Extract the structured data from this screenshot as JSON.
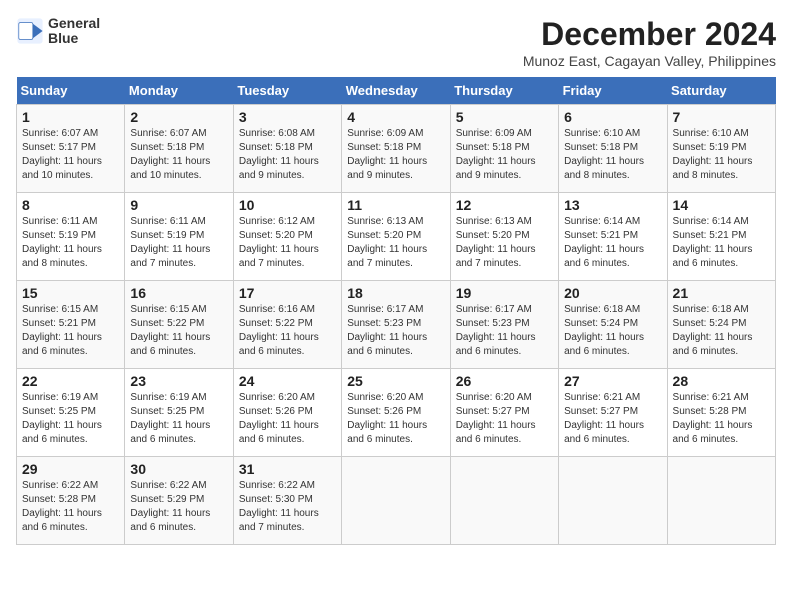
{
  "header": {
    "logo_line1": "General",
    "logo_line2": "Blue",
    "title": "December 2024",
    "subtitle": "Munoz East, Cagayan Valley, Philippines"
  },
  "days_of_week": [
    "Sunday",
    "Monday",
    "Tuesday",
    "Wednesday",
    "Thursday",
    "Friday",
    "Saturday"
  ],
  "weeks": [
    [
      {
        "day": 1,
        "info": "Sunrise: 6:07 AM\nSunset: 5:17 PM\nDaylight: 11 hours\nand 10 minutes."
      },
      {
        "day": 2,
        "info": "Sunrise: 6:07 AM\nSunset: 5:18 PM\nDaylight: 11 hours\nand 10 minutes."
      },
      {
        "day": 3,
        "info": "Sunrise: 6:08 AM\nSunset: 5:18 PM\nDaylight: 11 hours\nand 9 minutes."
      },
      {
        "day": 4,
        "info": "Sunrise: 6:09 AM\nSunset: 5:18 PM\nDaylight: 11 hours\nand 9 minutes."
      },
      {
        "day": 5,
        "info": "Sunrise: 6:09 AM\nSunset: 5:18 PM\nDaylight: 11 hours\nand 9 minutes."
      },
      {
        "day": 6,
        "info": "Sunrise: 6:10 AM\nSunset: 5:18 PM\nDaylight: 11 hours\nand 8 minutes."
      },
      {
        "day": 7,
        "info": "Sunrise: 6:10 AM\nSunset: 5:19 PM\nDaylight: 11 hours\nand 8 minutes."
      }
    ],
    [
      {
        "day": 8,
        "info": "Sunrise: 6:11 AM\nSunset: 5:19 PM\nDaylight: 11 hours\nand 8 minutes."
      },
      {
        "day": 9,
        "info": "Sunrise: 6:11 AM\nSunset: 5:19 PM\nDaylight: 11 hours\nand 7 minutes."
      },
      {
        "day": 10,
        "info": "Sunrise: 6:12 AM\nSunset: 5:20 PM\nDaylight: 11 hours\nand 7 minutes."
      },
      {
        "day": 11,
        "info": "Sunrise: 6:13 AM\nSunset: 5:20 PM\nDaylight: 11 hours\nand 7 minutes."
      },
      {
        "day": 12,
        "info": "Sunrise: 6:13 AM\nSunset: 5:20 PM\nDaylight: 11 hours\nand 7 minutes."
      },
      {
        "day": 13,
        "info": "Sunrise: 6:14 AM\nSunset: 5:21 PM\nDaylight: 11 hours\nand 6 minutes."
      },
      {
        "day": 14,
        "info": "Sunrise: 6:14 AM\nSunset: 5:21 PM\nDaylight: 11 hours\nand 6 minutes."
      }
    ],
    [
      {
        "day": 15,
        "info": "Sunrise: 6:15 AM\nSunset: 5:21 PM\nDaylight: 11 hours\nand 6 minutes."
      },
      {
        "day": 16,
        "info": "Sunrise: 6:15 AM\nSunset: 5:22 PM\nDaylight: 11 hours\nand 6 minutes."
      },
      {
        "day": 17,
        "info": "Sunrise: 6:16 AM\nSunset: 5:22 PM\nDaylight: 11 hours\nand 6 minutes."
      },
      {
        "day": 18,
        "info": "Sunrise: 6:17 AM\nSunset: 5:23 PM\nDaylight: 11 hours\nand 6 minutes."
      },
      {
        "day": 19,
        "info": "Sunrise: 6:17 AM\nSunset: 5:23 PM\nDaylight: 11 hours\nand 6 minutes."
      },
      {
        "day": 20,
        "info": "Sunrise: 6:18 AM\nSunset: 5:24 PM\nDaylight: 11 hours\nand 6 minutes."
      },
      {
        "day": 21,
        "info": "Sunrise: 6:18 AM\nSunset: 5:24 PM\nDaylight: 11 hours\nand 6 minutes."
      }
    ],
    [
      {
        "day": 22,
        "info": "Sunrise: 6:19 AM\nSunset: 5:25 PM\nDaylight: 11 hours\nand 6 minutes."
      },
      {
        "day": 23,
        "info": "Sunrise: 6:19 AM\nSunset: 5:25 PM\nDaylight: 11 hours\nand 6 minutes."
      },
      {
        "day": 24,
        "info": "Sunrise: 6:20 AM\nSunset: 5:26 PM\nDaylight: 11 hours\nand 6 minutes."
      },
      {
        "day": 25,
        "info": "Sunrise: 6:20 AM\nSunset: 5:26 PM\nDaylight: 11 hours\nand 6 minutes."
      },
      {
        "day": 26,
        "info": "Sunrise: 6:20 AM\nSunset: 5:27 PM\nDaylight: 11 hours\nand 6 minutes."
      },
      {
        "day": 27,
        "info": "Sunrise: 6:21 AM\nSunset: 5:27 PM\nDaylight: 11 hours\nand 6 minutes."
      },
      {
        "day": 28,
        "info": "Sunrise: 6:21 AM\nSunset: 5:28 PM\nDaylight: 11 hours\nand 6 minutes."
      }
    ],
    [
      {
        "day": 29,
        "info": "Sunrise: 6:22 AM\nSunset: 5:28 PM\nDaylight: 11 hours\nand 6 minutes."
      },
      {
        "day": 30,
        "info": "Sunrise: 6:22 AM\nSunset: 5:29 PM\nDaylight: 11 hours\nand 6 minutes."
      },
      {
        "day": 31,
        "info": "Sunrise: 6:22 AM\nSunset: 5:30 PM\nDaylight: 11 hours\nand 7 minutes."
      },
      null,
      null,
      null,
      null
    ]
  ]
}
